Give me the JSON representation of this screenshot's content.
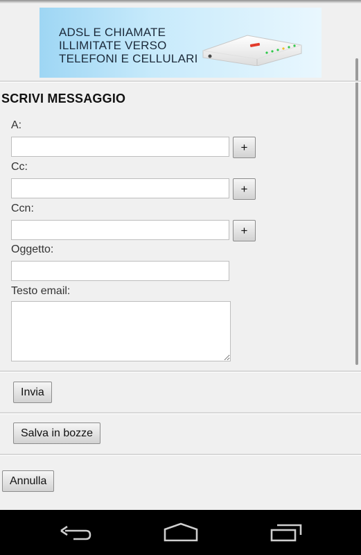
{
  "ad_banner": {
    "line1": "ADSL E CHIAMATE",
    "line2": "ILLIMITATE VERSO",
    "line3": "TELEFONI E CELLULARI"
  },
  "page": {
    "title": "SCRIVI MESSAGGIO"
  },
  "form": {
    "to_label": "A:",
    "to_value": "",
    "cc_label": "Cc:",
    "cc_value": "",
    "bcc_label": "Ccn:",
    "bcc_value": "",
    "subject_label": "Oggetto:",
    "subject_value": "",
    "body_label": "Testo email:",
    "body_value": "",
    "add_label": "+"
  },
  "actions": {
    "send_label": "Invia",
    "save_draft_label": "Salva in bozze",
    "cancel_label": "Annulla"
  },
  "system_nav": {
    "back_icon": "back-icon",
    "home_icon": "home-icon",
    "recents_icon": "recent-apps-icon"
  }
}
